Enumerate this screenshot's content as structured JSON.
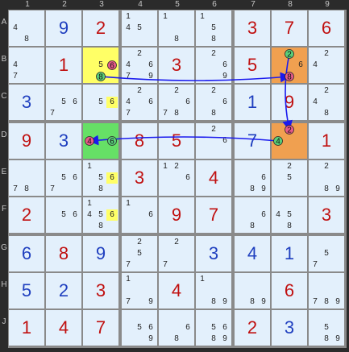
{
  "columns": [
    "1",
    "2",
    "3",
    "4",
    "5",
    "6",
    "7",
    "8",
    "9"
  ],
  "rows": [
    "A",
    "B",
    "C",
    "D",
    "E",
    "F",
    "G",
    "H",
    "J"
  ],
  "cells": [
    [
      {
        "cands": "4,8"
      },
      {
        "v": "9",
        "c": "blue"
      },
      {
        "v": "2",
        "c": "red"
      },
      {
        "cands": "1,4,5"
      },
      {
        "cands": "1,8"
      },
      {
        "cands": "1,5,8"
      },
      {
        "v": "3",
        "c": "red"
      },
      {
        "v": "7",
        "c": "red"
      },
      {
        "v": "6",
        "c": "red"
      }
    ],
    [
      {
        "cands": "4,7"
      },
      {
        "v": "1",
        "c": "red"
      },
      {
        "cands": "5,6,8",
        "bg": "yellow"
      },
      {
        "cands": "2,4,6,7,9"
      },
      {
        "v": "3",
        "c": "red"
      },
      {
        "cands": "2,6,9"
      },
      {
        "v": "5",
        "c": "red"
      },
      {
        "cands": "2,6,8",
        "bg": "orange"
      },
      {
        "cands": "2,4"
      }
    ],
    [
      {
        "v": "3",
        "c": "blue"
      },
      {
        "cands": "5,6,7"
      },
      {
        "cands": "5,6",
        "hl": "6"
      },
      {
        "cands": "2,4,6,7"
      },
      {
        "cands": "2,6,7,8"
      },
      {
        "cands": "2,6,8"
      },
      {
        "v": "1",
        "c": "blue"
      },
      {
        "v": "9",
        "c": "red"
      },
      {
        "cands": "2,4,8"
      }
    ],
    [
      {
        "v": "9",
        "c": "red"
      },
      {
        "v": "3",
        "c": "blue"
      },
      {
        "cands": "4,6",
        "bg": "green"
      },
      {
        "v": "8",
        "c": "red"
      },
      {
        "v": "5",
        "c": "red"
      },
      {
        "cands": "2,6"
      },
      {
        "v": "7",
        "c": "blue"
      },
      {
        "cands": "2,4",
        "bg": "orange"
      },
      {
        "v": "1",
        "c": "red"
      }
    ],
    [
      {
        "cands": "7,8"
      },
      {
        "cands": "5,6,7"
      },
      {
        "cands": "1,5,6,8",
        "hl": "6"
      },
      {
        "v": "3",
        "c": "red"
      },
      {
        "cands": "1,2,6"
      },
      {
        "v": "4",
        "c": "red"
      },
      {
        "cands": "6,8,9"
      },
      {
        "cands": "2,5"
      },
      {
        "cands": "2,8,9"
      }
    ],
    [
      {
        "v": "2",
        "c": "red"
      },
      {
        "cands": "5,6"
      },
      {
        "cands": "1,4,5,6,8",
        "hl": "6"
      },
      {
        "cands": "1,6"
      },
      {
        "v": "9",
        "c": "red"
      },
      {
        "v": "7",
        "c": "red"
      },
      {
        "cands": "6,8"
      },
      {
        "cands": "4,5,8"
      },
      {
        "v": "3",
        "c": "red"
      }
    ],
    [
      {
        "v": "6",
        "c": "blue"
      },
      {
        "v": "8",
        "c": "red"
      },
      {
        "v": "9",
        "c": "blue"
      },
      {
        "cands": "2,5,7"
      },
      {
        "cands": "2,7"
      },
      {
        "v": "3",
        "c": "blue"
      },
      {
        "v": "4",
        "c": "blue"
      },
      {
        "v": "1",
        "c": "blue"
      },
      {
        "cands": "5,7"
      }
    ],
    [
      {
        "v": "5",
        "c": "blue"
      },
      {
        "v": "2",
        "c": "blue"
      },
      {
        "v": "3",
        "c": "red"
      },
      {
        "cands": "1,7,9"
      },
      {
        "v": "4",
        "c": "red"
      },
      {
        "cands": "1,8,9"
      },
      {
        "cands": "8,9"
      },
      {
        "v": "6",
        "c": "red"
      },
      {
        "cands": "7,8,9"
      }
    ],
    [
      {
        "v": "1",
        "c": "red"
      },
      {
        "v": "4",
        "c": "red"
      },
      {
        "v": "7",
        "c": "red"
      },
      {
        "cands": "5,6,9"
      },
      {
        "cands": "6,8"
      },
      {
        "cands": "5,6,8,9"
      },
      {
        "v": "2",
        "c": "red"
      },
      {
        "v": "3",
        "c": "blue"
      },
      {
        "cands": "5,8,9"
      }
    ]
  ],
  "chain_markers": [
    {
      "cell": "B3",
      "digit": "6",
      "color": "red"
    },
    {
      "cell": "B3",
      "digit": "8",
      "color": "green"
    },
    {
      "cell": "B8",
      "digit": "2",
      "color": "green"
    },
    {
      "cell": "B8",
      "digit": "8",
      "color": "red"
    },
    {
      "cell": "D3",
      "digit": "4",
      "color": "red"
    },
    {
      "cell": "D3",
      "digit": "6",
      "color": "green"
    },
    {
      "cell": "D8",
      "digit": "2",
      "color": "red"
    },
    {
      "cell": "D8",
      "digit": "4",
      "color": "green"
    }
  ],
  "chain_links": [
    {
      "from": "B3-8",
      "to": "B8-8"
    },
    {
      "from": "B8-2",
      "to": "D8-2"
    },
    {
      "from": "D8-4",
      "to": "D3-4"
    }
  ],
  "colors": {
    "cell_bg": "#e3f0fc",
    "yellow": "#ffff66",
    "green": "#66e066",
    "orange": "#f0a050",
    "given_blue": "#1f3fbf",
    "given_red": "#c01010",
    "chain_line": "#1a1aee",
    "marker_red": "#e85a8a",
    "marker_green": "#5ad07a"
  }
}
